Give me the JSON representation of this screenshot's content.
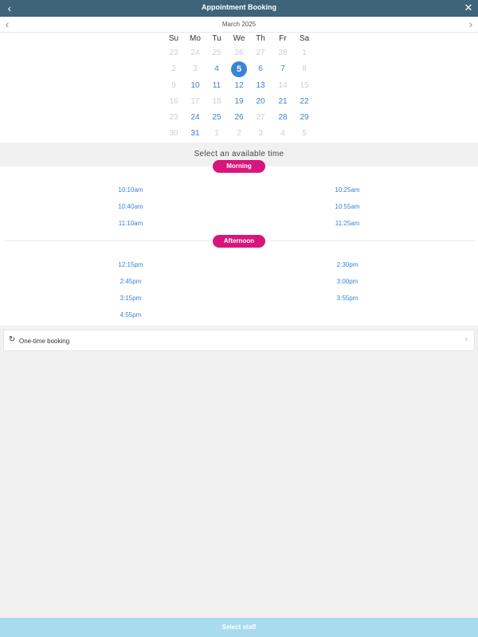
{
  "header": {
    "title": "Appointment Booking",
    "back_icon": "‹",
    "close_icon": "✕"
  },
  "calendar": {
    "month_title": "March 2025",
    "prev_icon": "‹",
    "next_icon": "›",
    "weekdays": [
      "Su",
      "Mo",
      "Tu",
      "We",
      "Th",
      "Fr",
      "Sa"
    ],
    "weeks": [
      [
        {
          "d": "23",
          "s": "muted"
        },
        {
          "d": "24",
          "s": "muted"
        },
        {
          "d": "25",
          "s": "muted"
        },
        {
          "d": "26",
          "s": "muted"
        },
        {
          "d": "27",
          "s": "muted"
        },
        {
          "d": "28",
          "s": "muted"
        },
        {
          "d": "1",
          "s": "muted"
        }
      ],
      [
        {
          "d": "2",
          "s": "muted"
        },
        {
          "d": "3",
          "s": "muted"
        },
        {
          "d": "4",
          "s": "avail"
        },
        {
          "d": "5",
          "s": "sel"
        },
        {
          "d": "6",
          "s": "avail"
        },
        {
          "d": "7",
          "s": "avail"
        },
        {
          "d": "8",
          "s": "muted"
        }
      ],
      [
        {
          "d": "9",
          "s": "muted"
        },
        {
          "d": "10",
          "s": "avail"
        },
        {
          "d": "11",
          "s": "avail"
        },
        {
          "d": "12",
          "s": "avail"
        },
        {
          "d": "13",
          "s": "avail"
        },
        {
          "d": "14",
          "s": "muted"
        },
        {
          "d": "15",
          "s": "muted"
        }
      ],
      [
        {
          "d": "16",
          "s": "muted"
        },
        {
          "d": "17",
          "s": "muted"
        },
        {
          "d": "18",
          "s": "muted"
        },
        {
          "d": "19",
          "s": "avail"
        },
        {
          "d": "20",
          "s": "avail"
        },
        {
          "d": "21",
          "s": "avail"
        },
        {
          "d": "22",
          "s": "avail"
        }
      ],
      [
        {
          "d": "23",
          "s": "muted"
        },
        {
          "d": "24",
          "s": "avail"
        },
        {
          "d": "25",
          "s": "avail"
        },
        {
          "d": "26",
          "s": "avail"
        },
        {
          "d": "27",
          "s": "muted"
        },
        {
          "d": "28",
          "s": "avail"
        },
        {
          "d": "29",
          "s": "avail"
        }
      ],
      [
        {
          "d": "30",
          "s": "muted"
        },
        {
          "d": "31",
          "s": "avail"
        },
        {
          "d": "1",
          "s": "muted"
        },
        {
          "d": "2",
          "s": "muted"
        },
        {
          "d": "3",
          "s": "muted"
        },
        {
          "d": "4",
          "s": "muted"
        },
        {
          "d": "5",
          "s": "muted"
        }
      ]
    ]
  },
  "times": {
    "prompt": "Select an available time",
    "morning": {
      "label": "Morning",
      "left": [
        "10:10am",
        "10:40am",
        "11:10am"
      ],
      "right": [
        "10:25am",
        "10:55am",
        "11:25am"
      ]
    },
    "afternoon": {
      "label": "Afternoon",
      "left": [
        "12:15pm",
        "2:45pm",
        "3:15pm",
        "4:55pm"
      ],
      "right": [
        "2:30pm",
        "3:00pm",
        "3:55pm"
      ]
    }
  },
  "booking": {
    "label": "One-time booking",
    "icon": "↻",
    "chevron": "›"
  },
  "footer": {
    "button_label": "Select staff"
  },
  "colors": {
    "header": "#3d6478",
    "accent": "#3a84d6",
    "pill": "#d9157d",
    "footer": "#a8dbee"
  }
}
